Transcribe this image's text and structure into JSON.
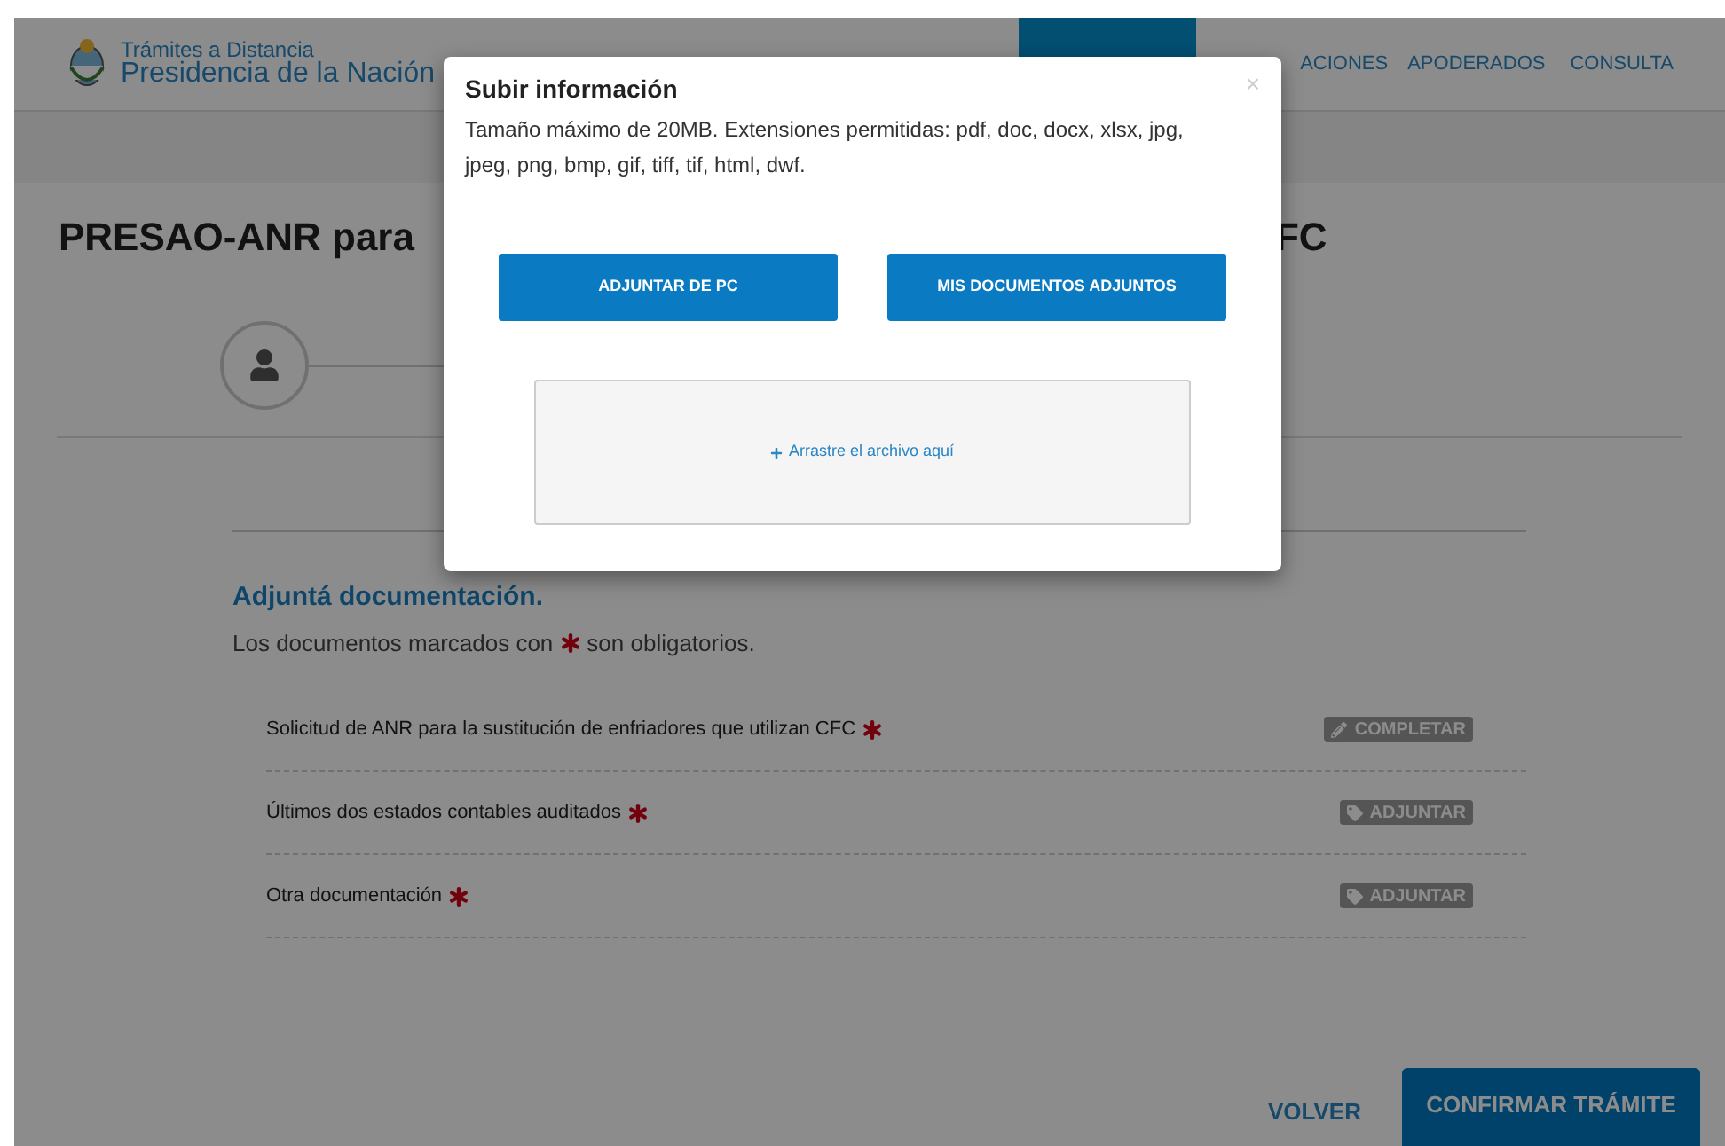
{
  "header": {
    "brand_small": "Trámites a Distancia",
    "brand_large": "Presidencia de la Nación"
  },
  "nav": [
    {
      "kind": "covered",
      "selected": false
    },
    {
      "kind": "covered",
      "selected": true
    },
    {
      "kind": "partly-covered",
      "label": "ACIONES",
      "selected": false
    },
    {
      "kind": "tab",
      "label": "APODERADOS",
      "selected": false
    },
    {
      "kind": "tab",
      "label": "CONSULTA",
      "selected": false
    }
  ],
  "page": {
    "title_start": "PRESAO-ANR para",
    "title_end": "FC"
  },
  "documents": {
    "heading": "Adjuntá documentación.",
    "legend_before": "Los documentos marcados con",
    "legend_after": "son obligatorios.",
    "rows": [
      {
        "name": "Solicitud de ANR para la sustitución de enfriadores que utilizan CFC",
        "required": true,
        "action": {
          "kind": "edit",
          "label": "COMPLETAR"
        }
      },
      {
        "name": "Últimos dos estados contables auditados",
        "required": true,
        "action": {
          "kind": "attach",
          "label": "ADJUNTAR"
        }
      },
      {
        "name": "Otra documentación",
        "required": true,
        "action": {
          "kind": "attach",
          "label": "ADJUNTAR"
        }
      }
    ]
  },
  "footer": {
    "back": "VOLVER",
    "confirm": "CONFIRMAR TRÁMITE"
  },
  "modal": {
    "title": "Subir información",
    "close": "×",
    "description": "Tamaño máximo de 20MB. Extensiones permitidas: pdf, doc, docx, xlsx, jpg, jpeg, png, bmp, gif, tiff, tif, html, dwf.",
    "buttons": [
      "ADJUNTAR DE PC",
      "MIS DOCUMENTOS ADJUNTOS"
    ],
    "dropzone": "Arrastre el archivo aquí"
  }
}
